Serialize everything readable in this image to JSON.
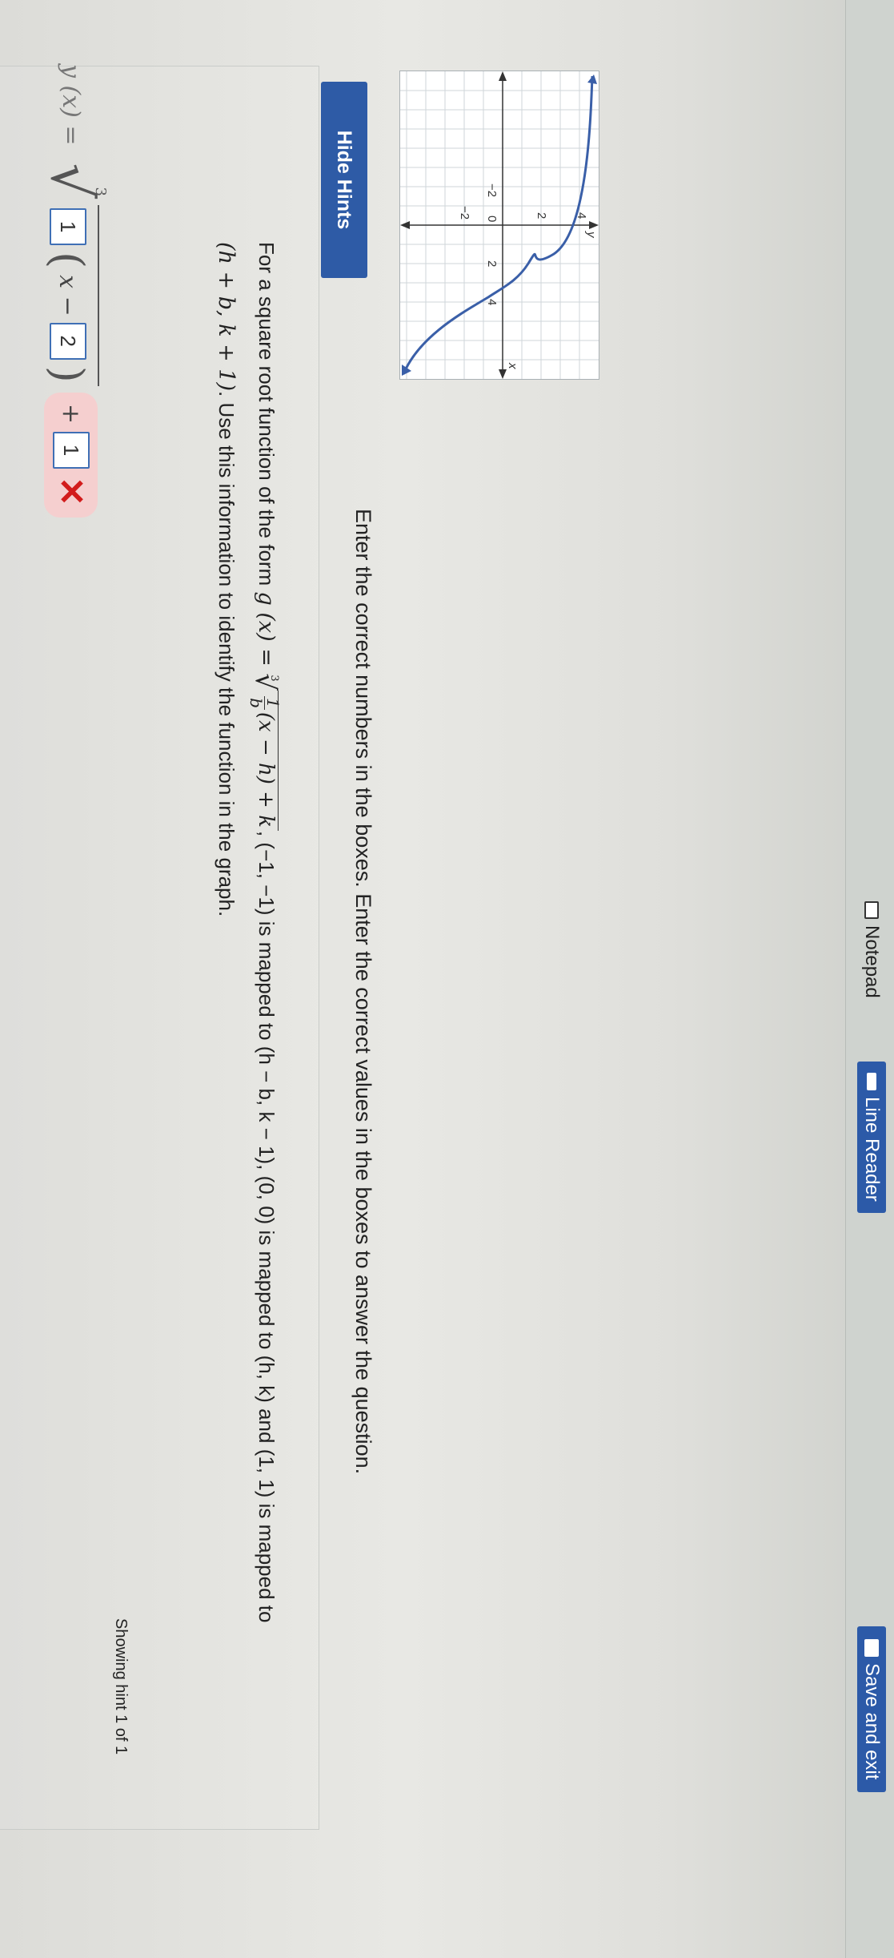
{
  "toolbar": {
    "notepad_label": "Notepad",
    "line_reader_label": "Line Reader",
    "save_exit_label": "Save and exit"
  },
  "graph": {
    "x_axis_label": "x",
    "y_axis_label": "y",
    "x_tick_labels": [
      "−2",
      "0",
      "2",
      "4"
    ],
    "y_tick_labels": [
      "4",
      "2",
      "−2"
    ],
    "curve_color": "#3a5fa8"
  },
  "instruction": "Enter the correct numbers in the boxes. Enter the correct values in the boxes to answer the question.",
  "hints": {
    "button_label": "Hide Hints",
    "line1_a": "For a square root function of the form ",
    "g_lhs": "g (x) = ",
    "radical_index": "3",
    "frac_num": "1",
    "frac_den": "b",
    "radicand": "(x − h) + k",
    "line1_b": ", (−1, −1) is mapped to (h − b, k − 1), (0, 0) is mapped to (h, k) and (1, 1) is mapped to",
    "line2_math": "(h + b, k + 1)",
    "line2_text": ". Use this information to identify the function in the graph.",
    "showing": "Showing hint 1 of 1"
  },
  "answer": {
    "lhs": "y (x) =",
    "radical_index": "3",
    "box1": "1",
    "x_minus": "x −",
    "box2": "2",
    "plus": "+",
    "box3": "1",
    "status": "incorrect",
    "error_color": "#d21c1c"
  }
}
